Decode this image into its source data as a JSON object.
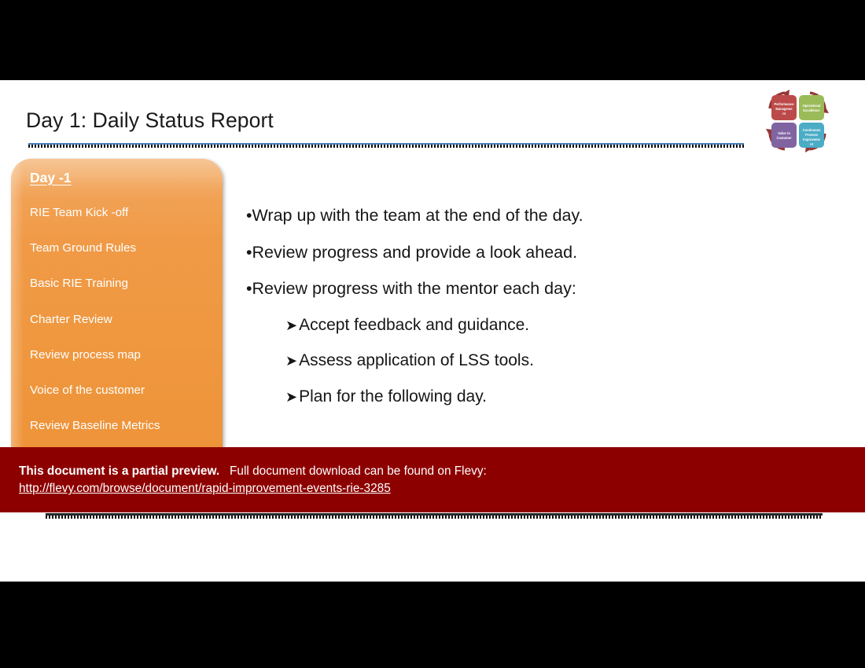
{
  "slide": {
    "title": "Day 1: Daily Status Report"
  },
  "day_panel": {
    "heading": "Day -1",
    "items": [
      {
        "label": "RIE Team Kick -off"
      },
      {
        "label": "Team Ground Rules"
      },
      {
        "label": "Basic RIE Training"
      },
      {
        "label": "Charter Review"
      },
      {
        "label": "Review process map"
      },
      {
        "label": "Voice of the customer"
      },
      {
        "label": "Review Baseline Metrics"
      }
    ]
  },
  "body": {
    "bullets": [
      {
        "marker": "•",
        "text": "Wrap up with the team at the end of the day.",
        "level": 1
      },
      {
        "marker": "•",
        "text": "Review progress and provide a look ahead.",
        "level": 1
      },
      {
        "marker": "•",
        "text": "Review progress with the mentor each day:",
        "level": 1
      },
      {
        "marker": "➤",
        "text": "Accept feedback and guidance.",
        "level": 2
      },
      {
        "marker": "➤",
        "text": "Assess application of LSS tools.",
        "level": 2
      },
      {
        "marker": "➤",
        "text": "Plan for the following day.",
        "level": 2
      }
    ]
  },
  "preview_banner": {
    "strong_text": "This document is a partial preview.",
    "rest_text": "Full document download can be found on Flevy:",
    "link_text": "http://flevy.com/browse/document/rapid-improvement-events-rie-3285",
    "background_color": "#8d0000"
  },
  "logo": {
    "name": "continuous-improvement-cycle-logo",
    "cells": [
      {
        "id": "performance-management",
        "lines": [
          "Performance",
          "Manageme",
          "nt"
        ],
        "color": "#bd4a4a"
      },
      {
        "id": "operational-excellence",
        "lines": [
          "Operational",
          "Excellence"
        ],
        "color": "#9bbb59"
      },
      {
        "id": "value-to-customer",
        "lines": [
          "Value to",
          "Customer"
        ],
        "color": "#8064a2"
      },
      {
        "id": "continuous-process-improvement",
        "lines": [
          "Continuous",
          "Process",
          "Improveme",
          "nt"
        ],
        "color": "#4bacc6"
      }
    ],
    "arrow_color": "#953735"
  },
  "theme": {
    "panel_orange": "#ef9840",
    "title_rule_blue": "#4a7ebb",
    "letterbox_black": "#000000",
    "canvas_white": "#ffffff"
  }
}
